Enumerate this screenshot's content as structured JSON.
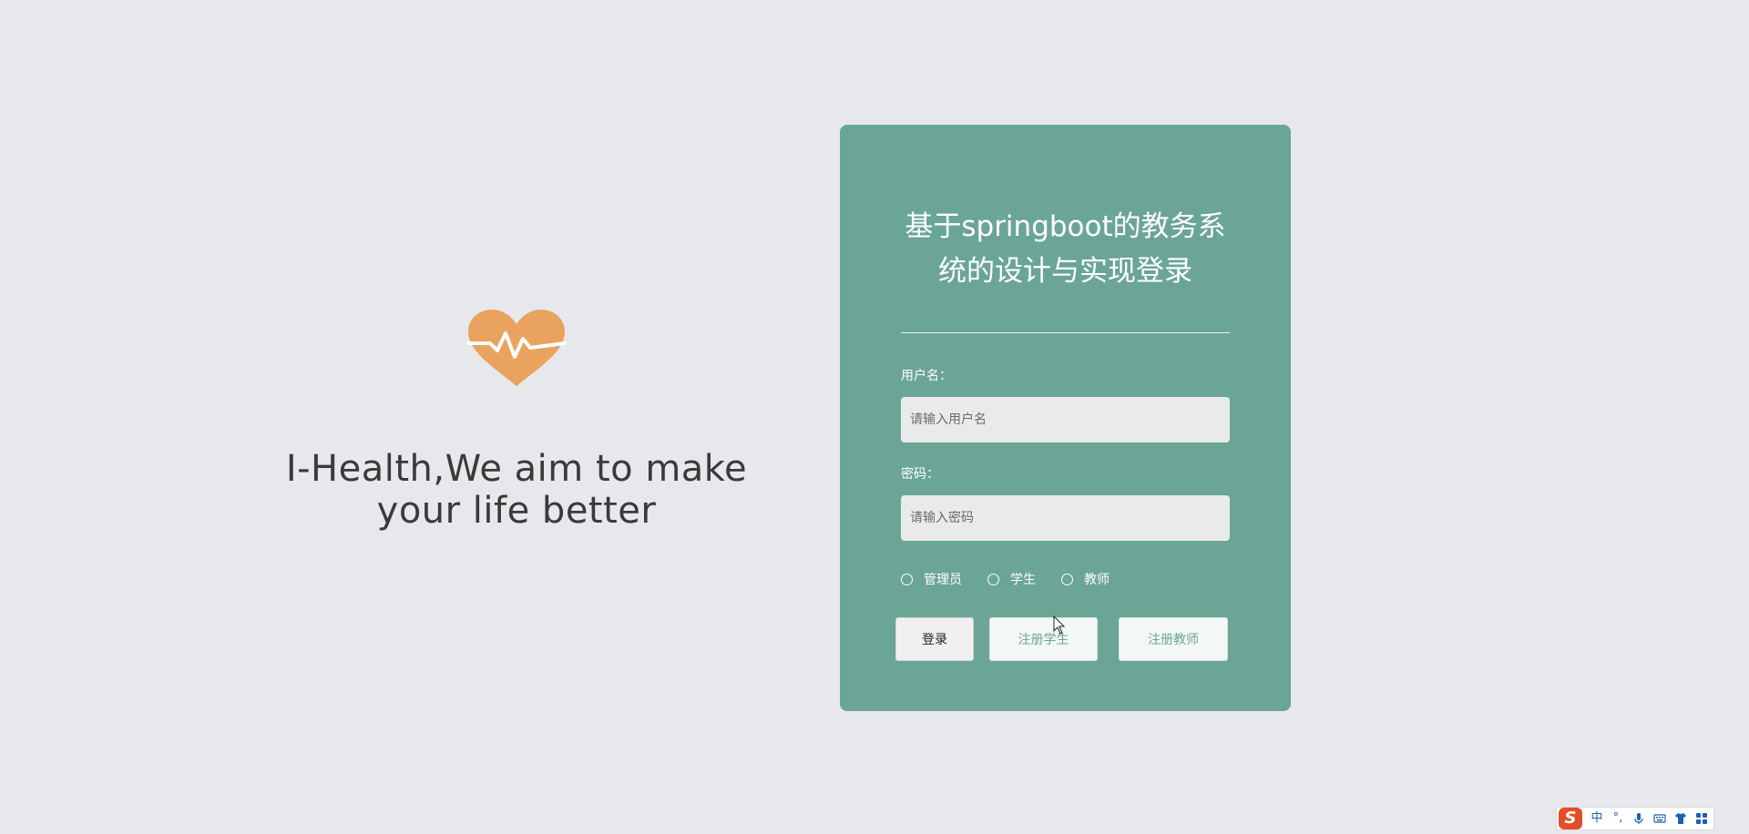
{
  "brand": {
    "tagline_line1": "I-Health,We aim to make",
    "tagline_line2": "your life better",
    "logo_icon": "heart-pulse-icon",
    "logo_color": "#e9a35e"
  },
  "login": {
    "title_line1": "基于springboot的教务系",
    "title_line2": "统的设计与实现登录",
    "username_label": "用户名：",
    "username_placeholder": "请输入用户名",
    "username_value": "",
    "password_label": "密码：",
    "password_placeholder": "请输入密码",
    "password_value": "",
    "roles": [
      {
        "label": "管理员",
        "selected": false
      },
      {
        "label": "学生",
        "selected": false
      },
      {
        "label": "教师",
        "selected": false
      }
    ],
    "login_button": "登录",
    "register_student_button": "注册学生",
    "register_teacher_button": "注册教师"
  },
  "ime_toolbar": {
    "logo": "S",
    "mode": "中",
    "punct": "°,",
    "icons": [
      "microphone-icon",
      "keyboard-icon",
      "shirt-icon",
      "grid-icon"
    ]
  },
  "colors": {
    "background": "#e7e8ec",
    "card": "#6ba596",
    "accent_text": "#6ba596",
    "ime_brand": "#e04f27"
  }
}
